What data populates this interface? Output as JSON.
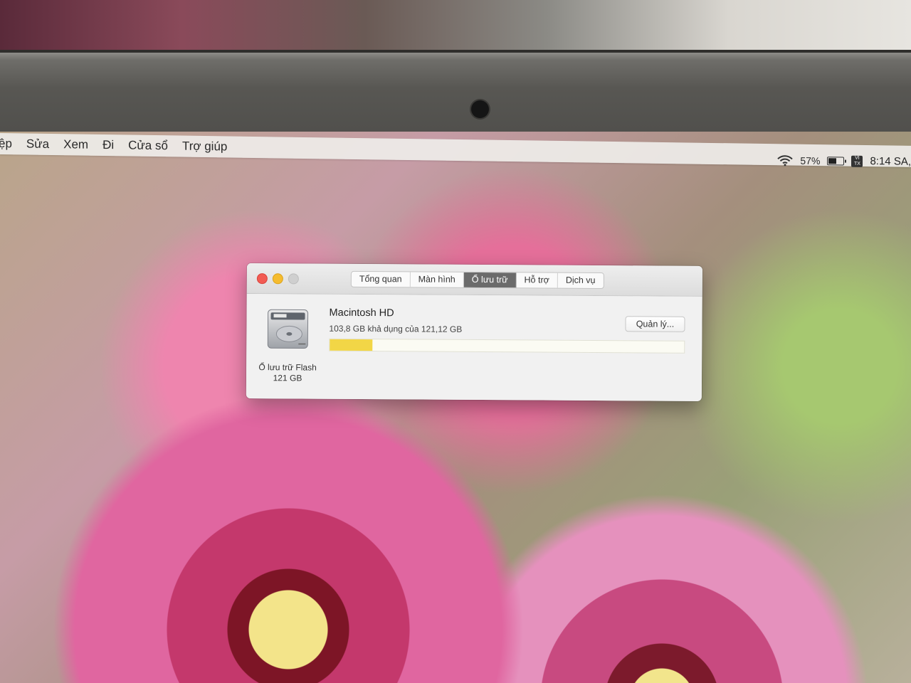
{
  "menubar": {
    "items": [
      "ệp",
      "Sửa",
      "Xem",
      "Đi",
      "Cửa sổ",
      "Trợ giúp"
    ],
    "battery_percent": "57%",
    "battery_level": 0.57,
    "clock": "8:14 SA,",
    "input_method_icon": "vietnamese-input-icon",
    "wifi_icon": "wifi-icon"
  },
  "window": {
    "tabs": [
      "Tổng quan",
      "Màn hình",
      "Ổ lưu trữ",
      "Hỗ trợ",
      "Dịch vụ"
    ],
    "active_tab": 2,
    "disk": {
      "icon": "hard-drive-icon",
      "caption_line1": "Ổ lưu trữ Flash",
      "caption_line2": "121 GB",
      "name": "Macintosh HD",
      "usage_text": "103,8 GB khả dụng của 121,12 GB",
      "used_fraction": 0.12
    },
    "manage_button": "Quản lý..."
  },
  "colors": {
    "close": "#f25b53",
    "minimize": "#f5bc2f",
    "zoom": "#cfcfcf",
    "storage_bar": "#f2d646",
    "active_tab": "#6b6b6b"
  }
}
